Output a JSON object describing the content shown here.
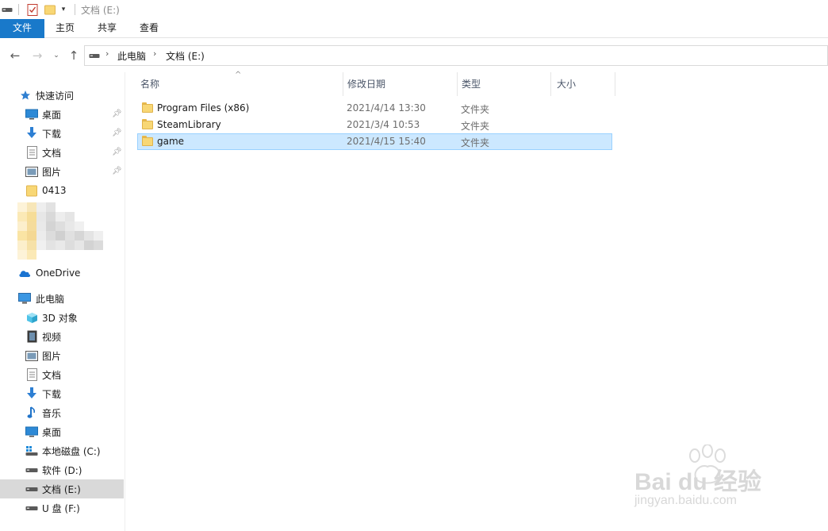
{
  "window": {
    "title": "文档 (E:)"
  },
  "ribbon": {
    "tabs": [
      "文件",
      "主页",
      "共享",
      "查看"
    ]
  },
  "address": {
    "crumbs": [
      "此电脑",
      "文档 (E:)"
    ]
  },
  "sidebar": {
    "quick_access": "快速访问",
    "quick_items": [
      {
        "label": "桌面",
        "icon": "desktop-icon",
        "pinned": true
      },
      {
        "label": "下载",
        "icon": "download-icon",
        "pinned": true
      },
      {
        "label": "文档",
        "icon": "document-icon",
        "pinned": true
      },
      {
        "label": "图片",
        "icon": "picture-icon",
        "pinned": true
      },
      {
        "label": "0413",
        "icon": "folder-icon",
        "pinned": false
      }
    ],
    "onedrive": "OneDrive",
    "this_pc": "此电脑",
    "pc_items": [
      {
        "label": "3D 对象",
        "icon": "3d-objects-icon"
      },
      {
        "label": "视频",
        "icon": "video-icon"
      },
      {
        "label": "图片",
        "icon": "picture-icon"
      },
      {
        "label": "文档",
        "icon": "document-icon"
      },
      {
        "label": "下载",
        "icon": "download-icon"
      },
      {
        "label": "音乐",
        "icon": "music-icon"
      },
      {
        "label": "桌面",
        "icon": "desktop-icon"
      },
      {
        "label": "本地磁盘 (C:)",
        "icon": "system-drive-icon"
      },
      {
        "label": "软件 (D:)",
        "icon": "drive-icon"
      },
      {
        "label": "文档 (E:)",
        "icon": "drive-icon",
        "selected": true
      },
      {
        "label": "U 盘 (F:)",
        "icon": "drive-icon"
      }
    ]
  },
  "columns": {
    "name": "名称",
    "date": "修改日期",
    "type": "类型",
    "size": "大小"
  },
  "files": [
    {
      "name": "Program Files (x86)",
      "date": "2021/4/14 13:30",
      "type": "文件夹",
      "selected": false
    },
    {
      "name": "SteamLibrary",
      "date": "2021/3/4 10:53",
      "type": "文件夹",
      "selected": false
    },
    {
      "name": "game",
      "date": "2021/4/15 15:40",
      "type": "文件夹",
      "selected": true
    }
  ],
  "watermark": {
    "brand": "Bai du 经验",
    "url": "jingyan.baidu.com"
  },
  "colors": {
    "accent": "#1979ca",
    "selection": "#cce8ff",
    "folder": "#f8d775"
  }
}
